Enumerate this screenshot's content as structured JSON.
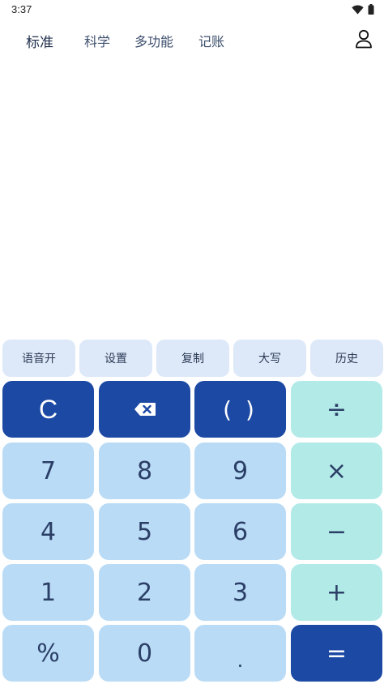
{
  "status_bar": {
    "time": "3:37",
    "icons": [
      "wifi-icon",
      "battery-icon"
    ]
  },
  "nav": {
    "tabs": [
      {
        "label": "标准",
        "active": true
      },
      {
        "label": "科学",
        "active": false
      },
      {
        "label": "多功能",
        "active": false
      },
      {
        "label": "记账",
        "active": false
      }
    ],
    "user_icon": "user-icon"
  },
  "functions": [
    {
      "label": "语音开"
    },
    {
      "label": "设置"
    },
    {
      "label": "复制"
    },
    {
      "label": "大写"
    },
    {
      "label": "历史"
    }
  ],
  "keypad": {
    "clear": "C",
    "backspace_icon": "backspace-icon",
    "parentheses": "( )",
    "divide": "÷",
    "seven": "7",
    "eight": "8",
    "nine": "9",
    "multiply": "×",
    "four": "4",
    "five": "5",
    "six": "6",
    "minus": "−",
    "one": "1",
    "two": "2",
    "three": "3",
    "plus": "+",
    "percent": "%",
    "zero": "0",
    "dot": ".",
    "equals": "="
  },
  "colors": {
    "number_key": "#b9dbf6",
    "operator_key": "#b2eae8",
    "accent_key": "#1c49a4",
    "function_button": "#dde8f8",
    "key_text": "#2b3f66"
  }
}
